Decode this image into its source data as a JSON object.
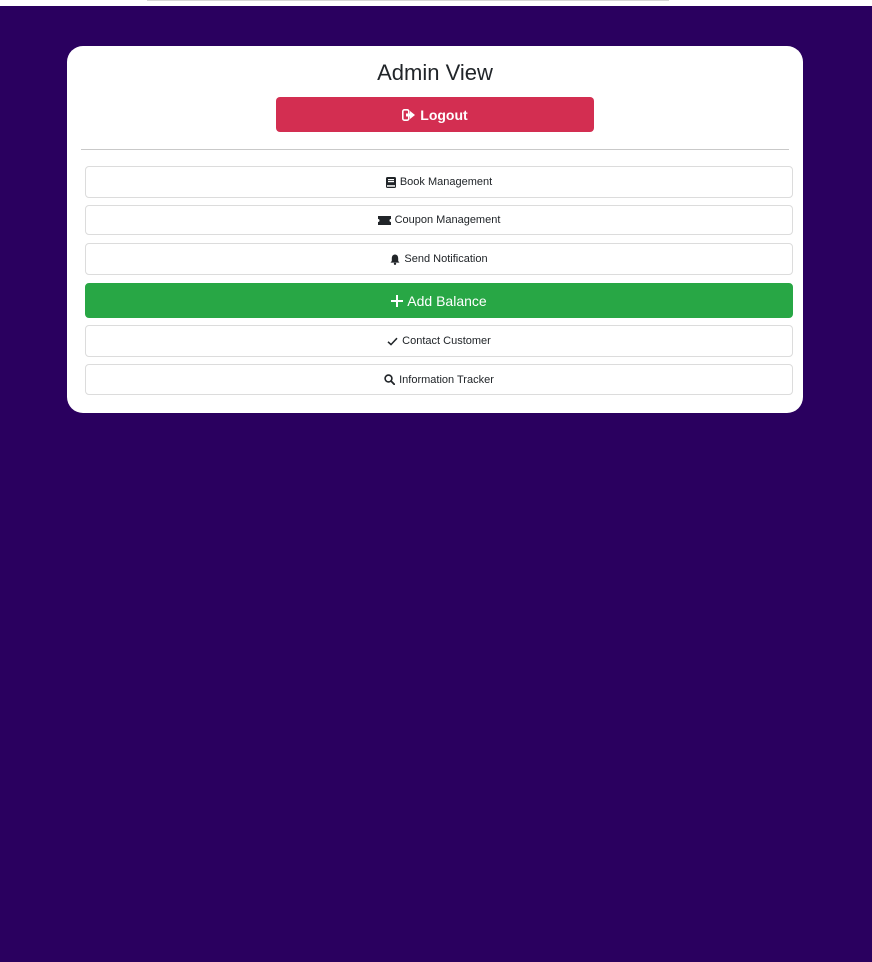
{
  "page": {
    "title": "Admin View"
  },
  "actions": {
    "logout_label": "Logout",
    "items": [
      {
        "label": "Book Management",
        "icon": "book-icon"
      },
      {
        "label": "Coupon Management",
        "icon": "ticket-icon"
      },
      {
        "label": "Send Notification",
        "icon": "bell-icon"
      },
      {
        "label": "Add Balance",
        "icon": "plus-icon"
      },
      {
        "label": "Contact Customer",
        "icon": "check-icon"
      },
      {
        "label": "Information Tracker",
        "icon": "search-icon"
      }
    ]
  },
  "colors": {
    "background": "#2a005f",
    "logout": "#d32e51",
    "primary_action": "#28a745"
  }
}
